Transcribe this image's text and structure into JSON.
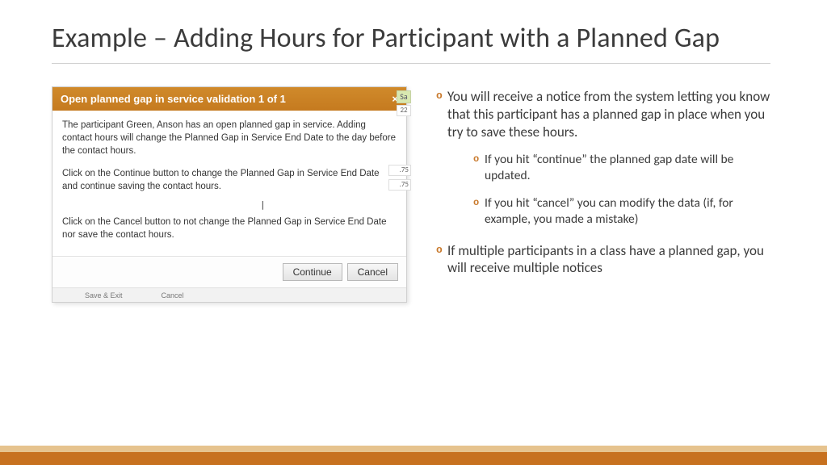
{
  "title": "Example – Adding Hours for Participant with a Planned Gap",
  "dialog": {
    "header": "Open planned gap in service validation 1 of 1",
    "close_glyph": "×",
    "para1": "The participant Green, Anson has an open planned gap in service. Adding contact hours will change the Planned Gap in Service End Date to the day before the contact hours.",
    "para2": "Click on the Continue button to change the Planned Gap in Service End Date and continue saving the contact hours.",
    "para3": "Click on the Cancel button to not change the Planned Gap in Service End Date nor save the contact hours.",
    "continue_label": "Continue",
    "cancel_label": "Cancel",
    "under_save": "Save & Exit",
    "under_cancel": "Cancel",
    "bg_sa": "Sa",
    "bg_22": "22",
    "bg_75a": ".75",
    "bg_75b": ".75"
  },
  "bullets": {
    "b1": "You will receive a notice from the system letting you know that this participant has a planned gap in place when you try to save these hours.",
    "b1a": "If you hit “continue” the planned gap date will be updated.",
    "b1b": "If you hit “cancel” you can modify the data (if, for example, you made a mistake)",
    "b2": "If multiple participants in a class have a planned gap, you will receive multiple notices"
  }
}
